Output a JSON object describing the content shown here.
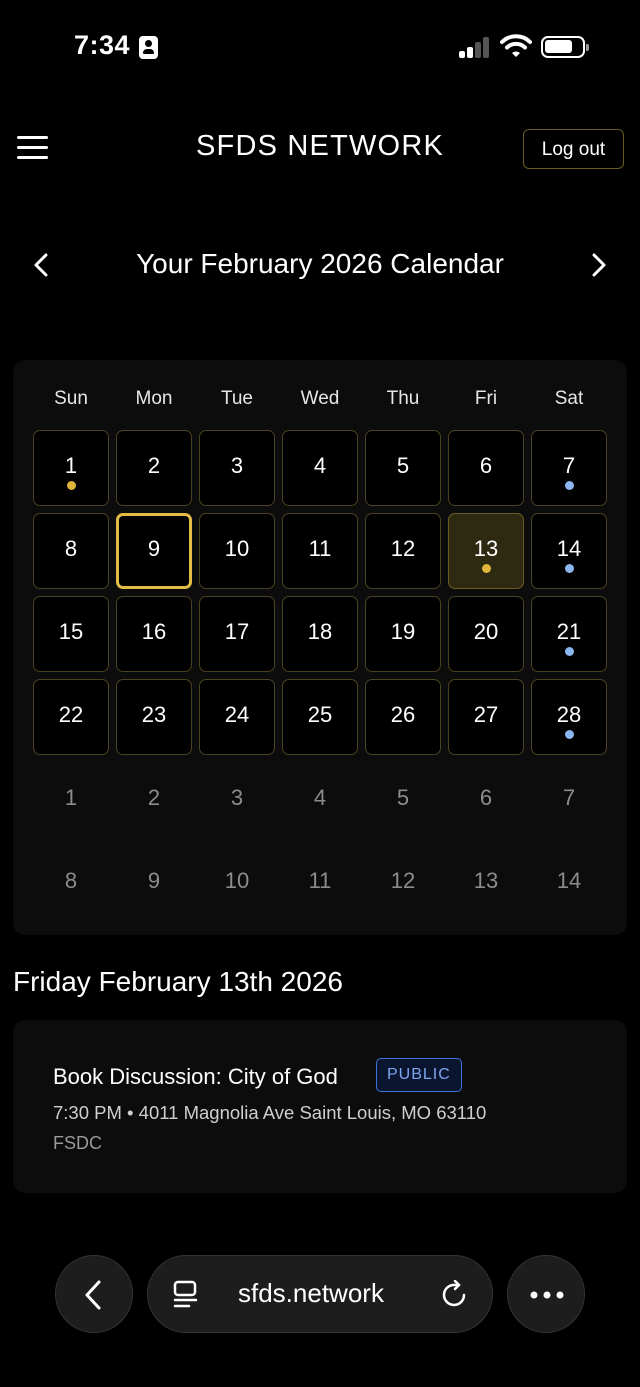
{
  "status_bar": {
    "time": "7:34"
  },
  "header": {
    "title": "SFDS NETWORK",
    "logout_label": "Log out"
  },
  "calendar": {
    "title": "Your February 2026 Calendar",
    "weekdays": [
      "Sun",
      "Mon",
      "Tue",
      "Wed",
      "Thu",
      "Fri",
      "Sat"
    ],
    "weeks": [
      [
        "1",
        "2",
        "3",
        "4",
        "5",
        "6",
        "7"
      ],
      [
        "8",
        "9",
        "10",
        "11",
        "12",
        "13",
        "14"
      ],
      [
        "15",
        "16",
        "17",
        "18",
        "19",
        "20",
        "21"
      ],
      [
        "22",
        "23",
        "24",
        "25",
        "26",
        "27",
        "28"
      ],
      [
        "1",
        "2",
        "3",
        "4",
        "5",
        "6",
        "7"
      ],
      [
        "8",
        "9",
        "10",
        "11",
        "12",
        "13",
        "14"
      ]
    ],
    "today": "9",
    "selected": "13",
    "event_dots": {
      "1": "gold",
      "7": "blue",
      "13": "gold",
      "14": "blue",
      "21": "blue",
      "28": "blue"
    },
    "colors": {
      "gold": "#e0b53c",
      "blue": "#8bb6f0",
      "today_border": "#e2bd45"
    }
  },
  "selected_day": {
    "heading": "Friday February 13th 2026",
    "event": {
      "title": "Book Discussion: City of God",
      "tag": "PUBLIC",
      "meta": "7:30 PM • 4011 Magnolia Ave Saint Louis, MO 63110",
      "org": "FSDC"
    }
  },
  "browser": {
    "url": "sfds.network",
    "icons": [
      "back-icon",
      "tabs-icon",
      "reload-icon",
      "more-icon"
    ]
  }
}
